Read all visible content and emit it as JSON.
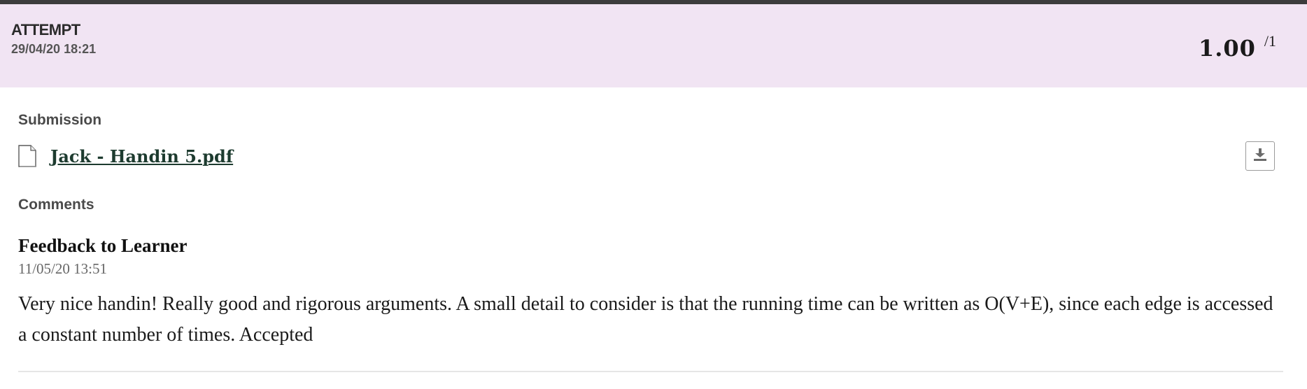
{
  "attempt": {
    "label": "ATTEMPT",
    "date": "29/04/20 18:21",
    "score": "1.00",
    "score_max": "/1"
  },
  "submission": {
    "label": "Submission",
    "file_name": "Jack - Handin 5.pdf",
    "file_icon": "document-icon",
    "download_icon": "download-icon"
  },
  "comments": {
    "label": "Comments",
    "feedback_title": "Feedback to Learner",
    "feedback_date": "11/05/20 13:51",
    "feedback_text": "Very nice handin! Really good and rigorous arguments. A small detail to consider is that the running time can be written as O(V+E), since each edge is accessed a constant number of times. Accepted"
  },
  "colors": {
    "header_background": "#f1e4f3",
    "top_rule": "#3c3c3c",
    "link": "#1d3b2f"
  }
}
